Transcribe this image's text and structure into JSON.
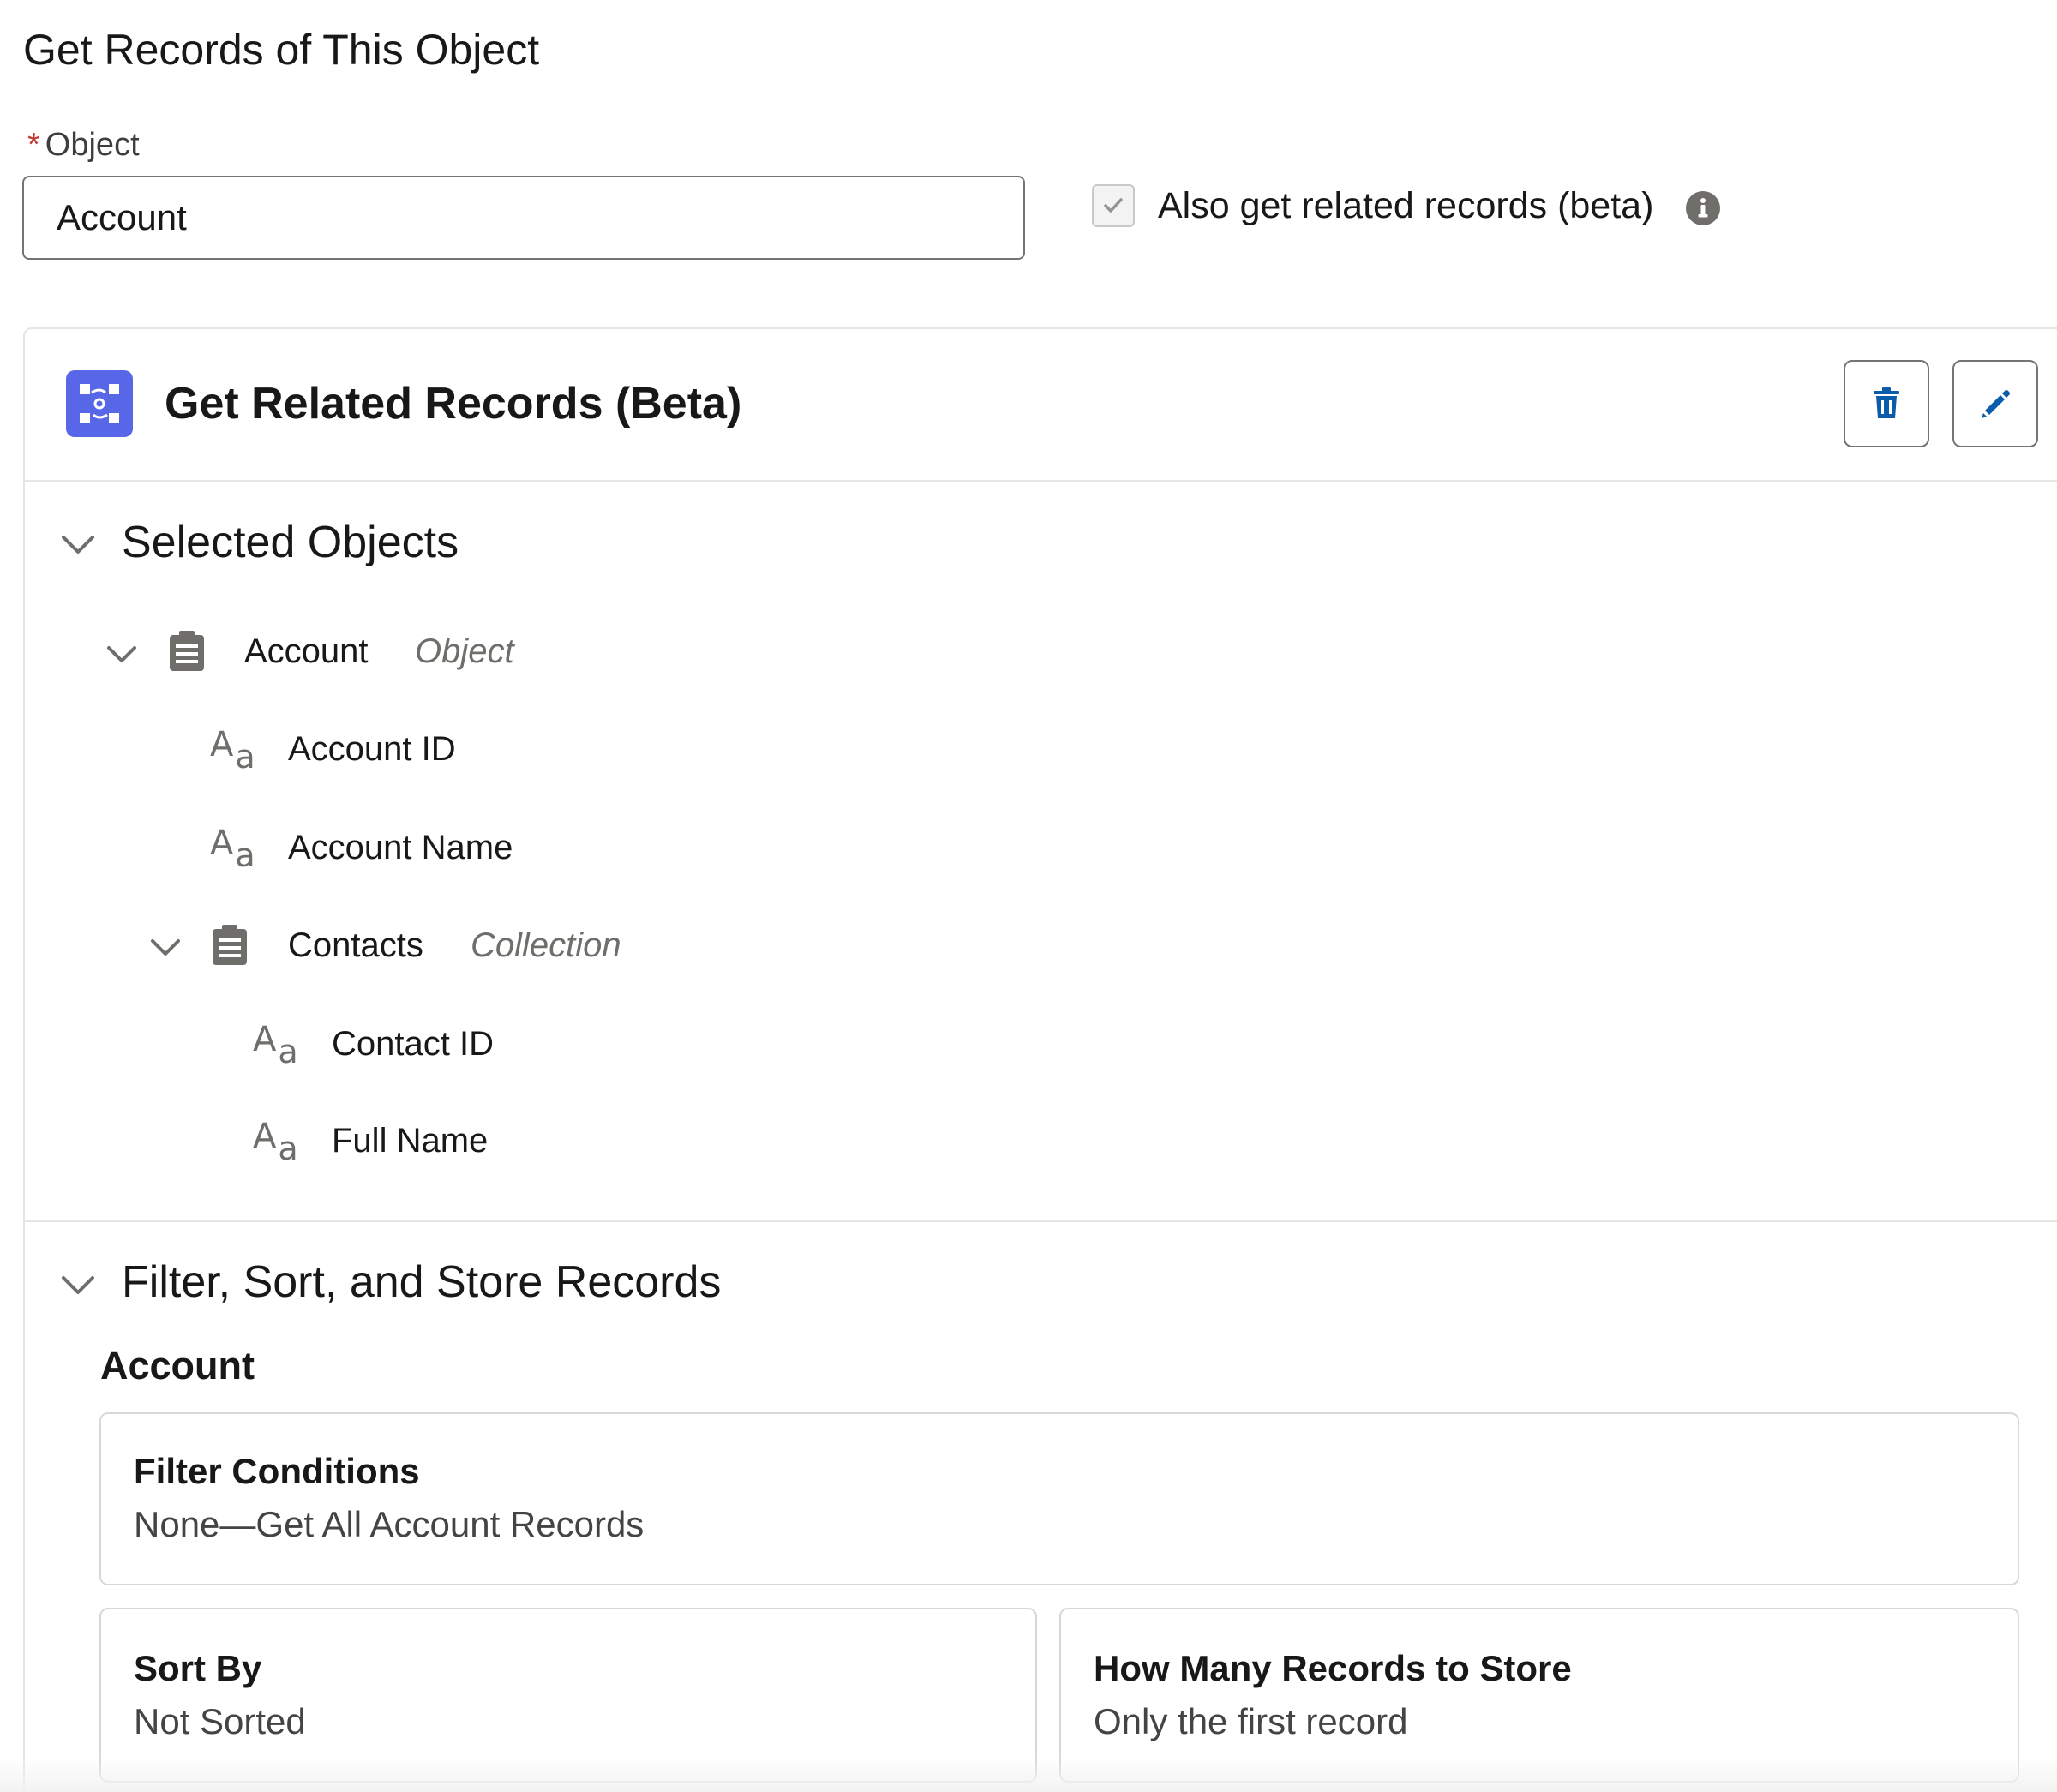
{
  "header": {
    "title": "Get Records of This Object"
  },
  "object_field": {
    "required_mark": "*",
    "label": "Object",
    "value": "Account"
  },
  "related": {
    "checkbox_label": "Also get related records (beta)",
    "checked": true
  },
  "card": {
    "title": "Get Related Records (Beta)",
    "accent_color": "#5867e8",
    "delete_icon": "trash-icon",
    "edit_icon": "pencil-icon"
  },
  "selected_objects": {
    "title": "Selected Objects",
    "tree": [
      {
        "label": "Account",
        "type": "Object"
      },
      {
        "label": "Account ID"
      },
      {
        "label": "Account Name"
      },
      {
        "label": "Contacts",
        "type": "Collection"
      },
      {
        "label": "Contact ID"
      },
      {
        "label": "Full Name"
      }
    ]
  },
  "filter_section": {
    "title": "Filter, Sort, and Store Records",
    "object_heading": "Account",
    "filter": {
      "title": "Filter Conditions",
      "value": "None—Get All Account Records"
    },
    "sort": {
      "title": "Sort By",
      "value": "Not Sorted"
    },
    "store": {
      "title": "How Many Records to Store",
      "value": "Only the first record"
    }
  }
}
